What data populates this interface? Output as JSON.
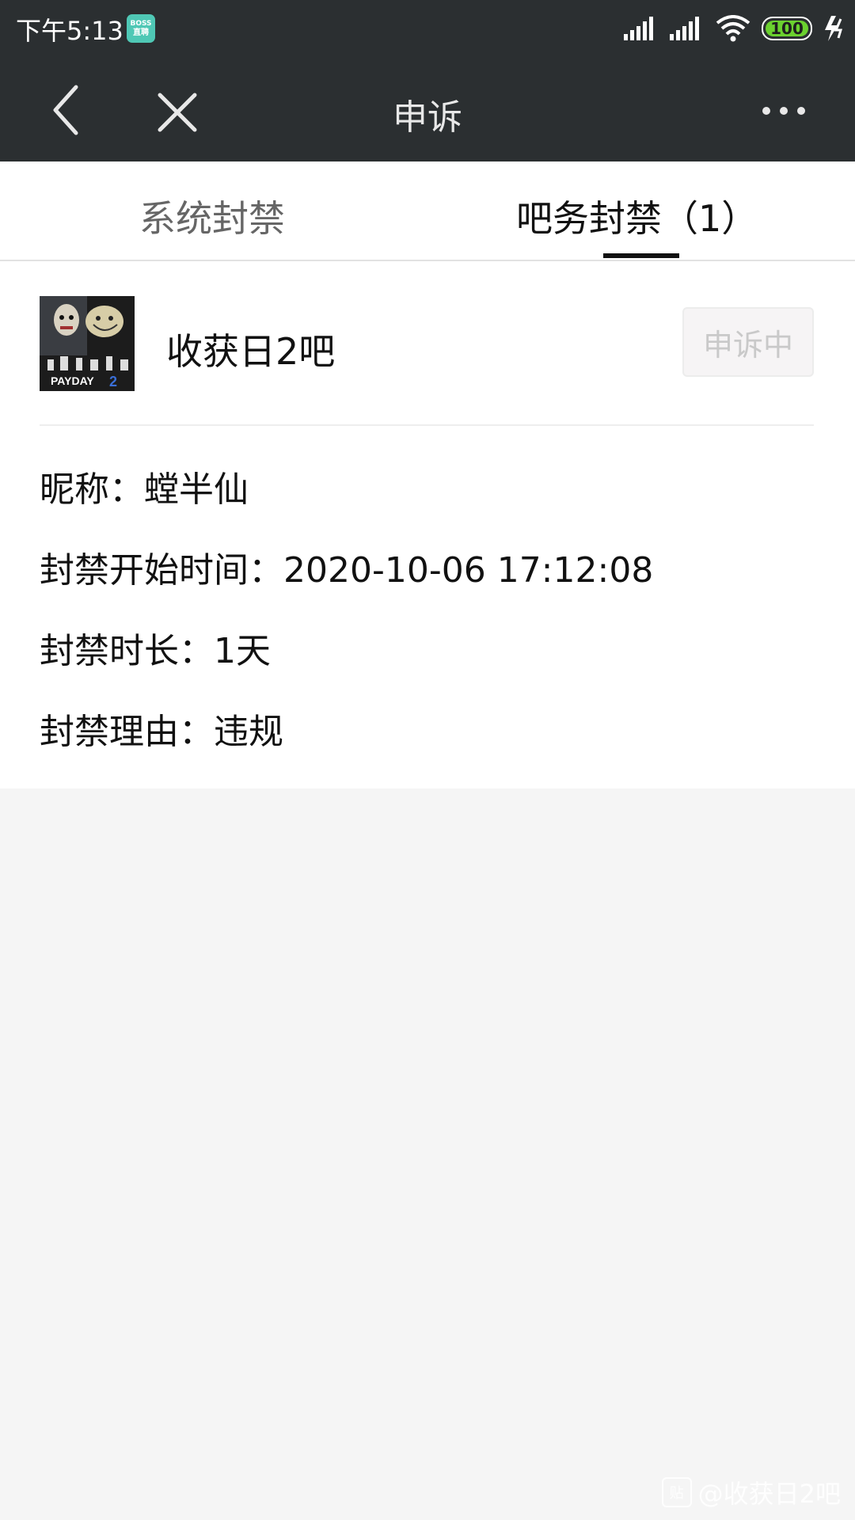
{
  "status_bar": {
    "time": "下午5:13",
    "boss_badge_line1": "BOSS",
    "boss_badge_line2": "直聘",
    "battery": "100"
  },
  "nav": {
    "title": "申诉"
  },
  "tabs": [
    {
      "label": "系统封禁",
      "active": false
    },
    {
      "label": "吧务封禁（1）",
      "active": true
    }
  ],
  "ban": {
    "forum_name": "收获日2吧",
    "avatar_text": "PAYDAY 2",
    "status": "申诉中",
    "nickname_label": "昵称：",
    "nickname": "螳半仙",
    "start_label": "封禁开始时间：",
    "start_time": "2020-10-06 17:12:08",
    "duration_label": "封禁时长：",
    "duration": "1天",
    "reason_label": "封禁理由：",
    "reason": "违规"
  },
  "watermark": {
    "text": "@收获日2吧"
  }
}
